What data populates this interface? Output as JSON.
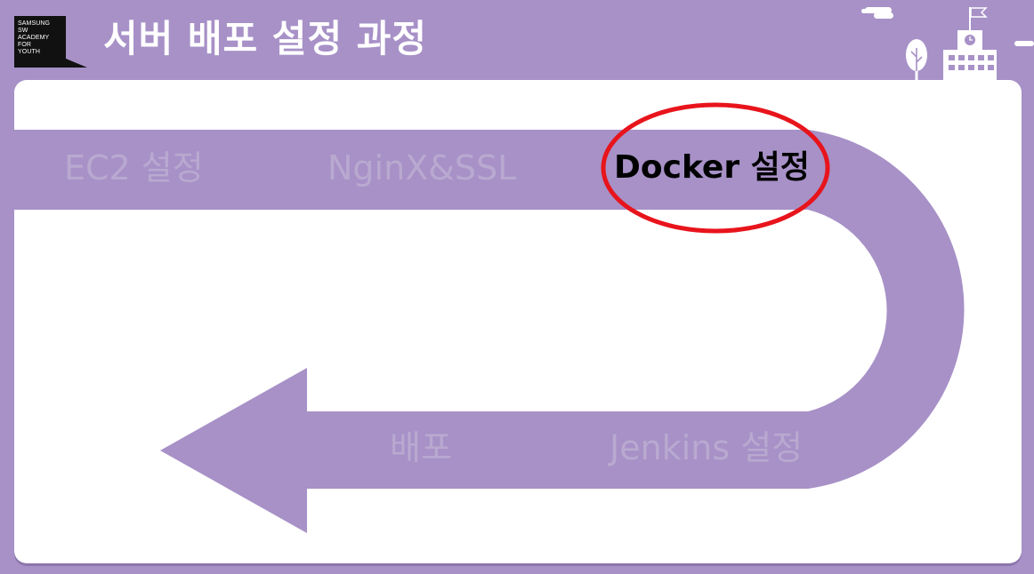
{
  "logo": {
    "lines": "SAMSUNG\nSW\nACADEMY\nFOR\nYOUTH"
  },
  "title": "서버 배포 설정 과정",
  "steps": [
    {
      "label": "EC2 설정",
      "active": false
    },
    {
      "label": "NginX&SSL",
      "active": false
    },
    {
      "label": "Docker 설정",
      "active": true
    },
    {
      "label": "Jenkins 설정",
      "active": false
    },
    {
      "label": "배포",
      "active": false
    }
  ],
  "highlight": {
    "target": "Docker 설정",
    "color": "#e8141c"
  },
  "colors": {
    "background": "#a791c7",
    "path": "#a791c7",
    "card": "#ffffff",
    "inactive_text": "#b9a9d0",
    "active_text": "#000000"
  },
  "icons": [
    "cloud-icon",
    "tree-icon",
    "school-building-icon",
    "flag-icon"
  ]
}
